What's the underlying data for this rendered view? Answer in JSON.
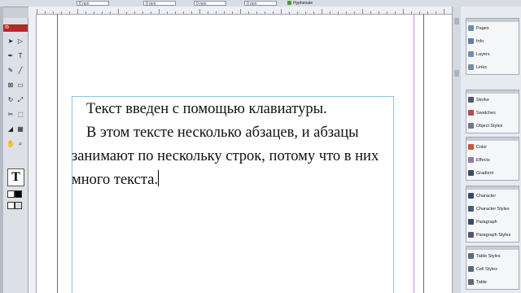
{
  "control_bar": {
    "fields": [
      "0 mm",
      "0 mm",
      "0 mm",
      "0 mm"
    ],
    "hyphenate_label": "Hyphenate"
  },
  "tools_panel": {
    "header": "tb",
    "tools": [
      "selection-tool",
      "direct-selection-tool",
      "pen-tool",
      "type-tool",
      "pencil-tool",
      "line-tool",
      "frame-tool",
      "rectangle-tool",
      "rotate-tool",
      "scale-tool",
      "scissors-tool",
      "free-transform-tool",
      "eyedropper-tool",
      "gradient-tool",
      "hand-tool",
      "zoom-tool"
    ],
    "active_tool_glyph": "T"
  },
  "document": {
    "paragraphs": [
      "Текст введен с помощью клавиатуры.",
      "В этом тексте несколько абзацев, и абзацы занимают по нескольку строк, потому что в них много текста."
    ]
  },
  "panels": {
    "groups": [
      [
        {
          "label": "Pages",
          "icon": "pages-icon",
          "color": "#6b8fb8"
        },
        {
          "label": "Info",
          "icon": "info-icon",
          "color": "#5d7fa8"
        },
        {
          "label": "Layers",
          "icon": "layers-icon",
          "color": "#6f8eb0"
        },
        {
          "label": "Links",
          "icon": "links-icon",
          "color": "#7a8ba0"
        }
      ],
      [
        {
          "label": "Stroke",
          "icon": "stroke-icon",
          "color": "#4d5a6a"
        },
        {
          "label": "Swatches",
          "icon": "swatches-icon",
          "color": "#b84a4a"
        },
        {
          "label": "Object Styles",
          "icon": "object-styles-icon",
          "color": "#6a7a8c"
        }
      ],
      [
        {
          "label": "Color",
          "icon": "color-icon",
          "color": "#c9553a"
        },
        {
          "label": "Effects",
          "icon": "effects-icon",
          "color": "#8a7ab0"
        },
        {
          "label": "Gradient",
          "icon": "gradient-icon",
          "color": "#3d4c5c"
        }
      ],
      [
        {
          "label": "Character",
          "icon": "character-icon",
          "color": "#3a4a6a"
        },
        {
          "label": "Character Styles",
          "icon": "character-styles-icon",
          "color": "#4a5a7a"
        },
        {
          "label": "Paragraph",
          "icon": "paragraph-icon",
          "color": "#3a4a6a"
        },
        {
          "label": "Paragraph Styles",
          "icon": "paragraph-styles-icon",
          "color": "#4a5a7a"
        }
      ],
      [
        {
          "label": "Table Styles",
          "icon": "table-styles-icon",
          "color": "#5a6a7a"
        },
        {
          "label": "Cell Styles",
          "icon": "cell-styles-icon",
          "color": "#5a6a7a"
        },
        {
          "label": "Table",
          "icon": "table-icon",
          "color": "#5a6a7a"
        }
      ]
    ]
  },
  "colors": {
    "tools_header": "#b32a2a",
    "text_frame_border": "#8fc4e8",
    "margin_guide": "#c79bd9"
  }
}
